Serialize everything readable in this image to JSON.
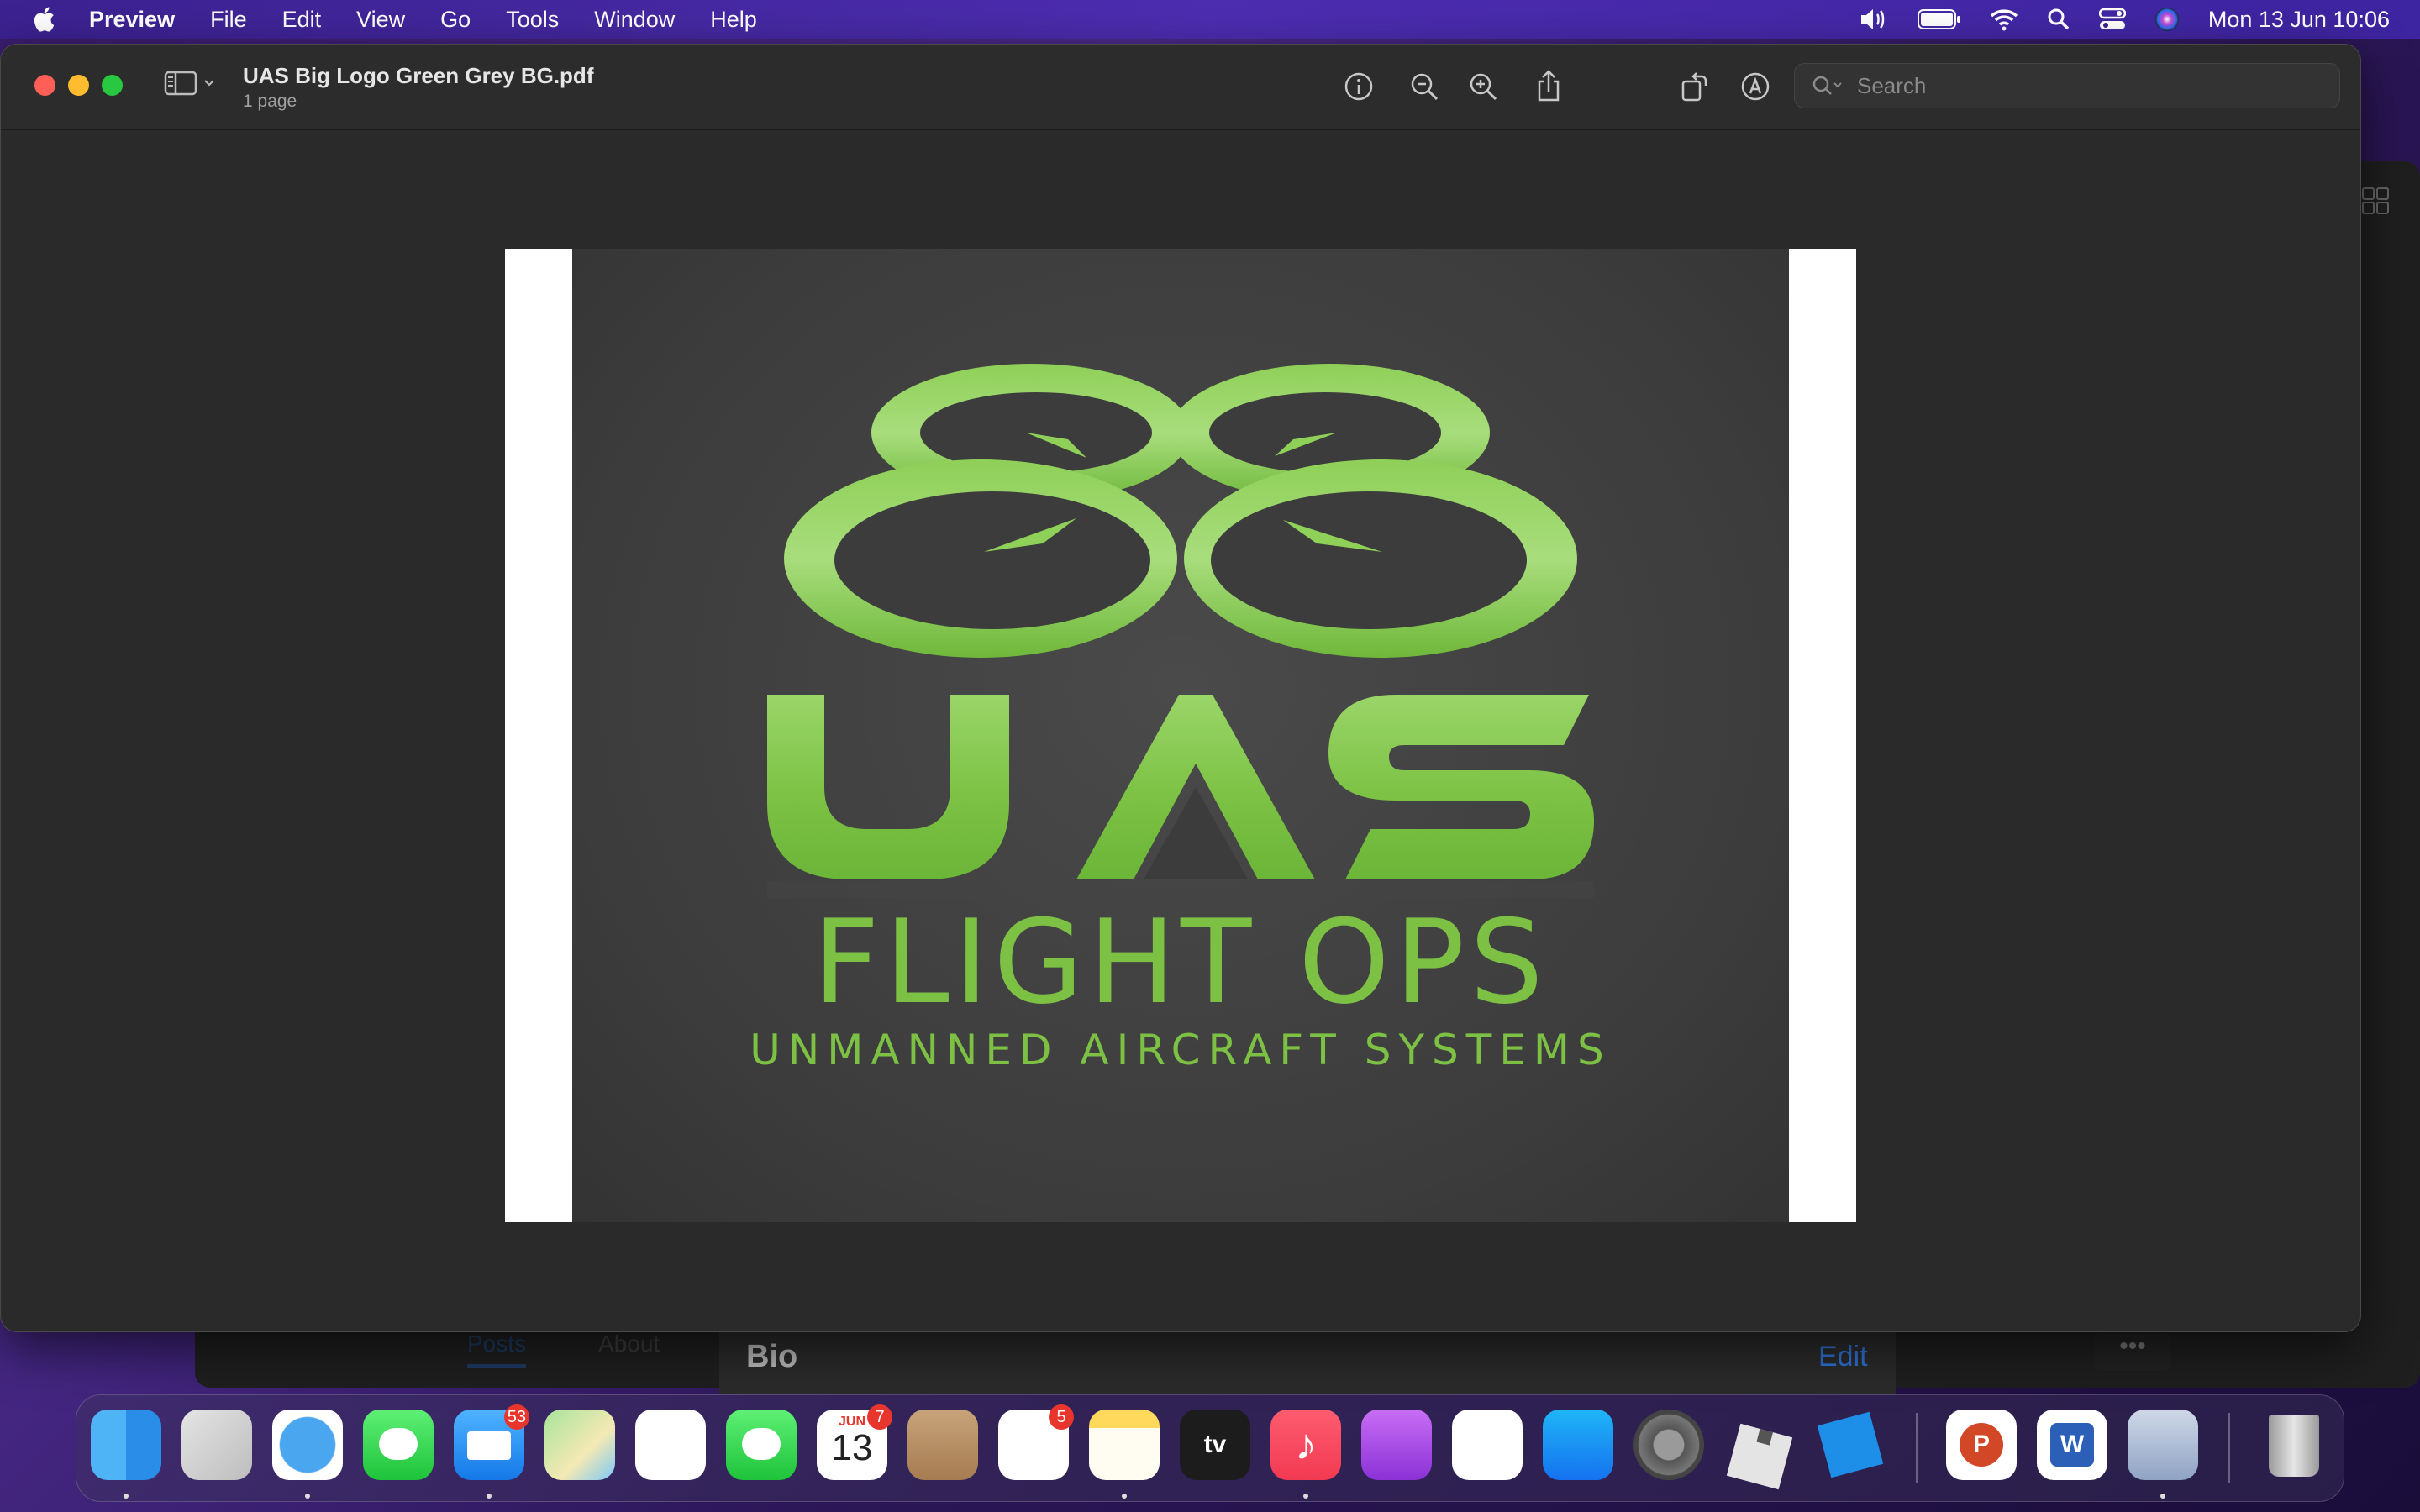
{
  "menubar": {
    "app_name": "Preview",
    "menus": [
      "File",
      "Edit",
      "View",
      "Go",
      "Tools",
      "Window",
      "Help"
    ],
    "clock": "Mon 13 Jun  10:06"
  },
  "window": {
    "title": "UAS Big Logo Green Grey BG.pdf",
    "subtitle": "1 page",
    "search_placeholder": "Search"
  },
  "document": {
    "logo_letters": "UAS",
    "logo_title": "FLIGHT OPS",
    "logo_subtitle": "UNMANNED AIRCRAFT SYSTEMS",
    "brand_green": "#7dc144"
  },
  "background_app": {
    "tabs": [
      "Posts",
      "About"
    ],
    "section_title": "Bio",
    "edit_label": "Edit",
    "more_label": "•••"
  },
  "dock": {
    "apps": [
      {
        "name": "Finder",
        "icon": "finder-icon",
        "running": true
      },
      {
        "name": "Launchpad",
        "icon": "launchpad-icon",
        "running": false
      },
      {
        "name": "Safari",
        "icon": "safari-icon",
        "running": true
      },
      {
        "name": "Messages",
        "icon": "messages-icon",
        "running": false
      },
      {
        "name": "Mail",
        "icon": "mail-icon",
        "running": true,
        "badge": "53"
      },
      {
        "name": "Maps",
        "icon": "maps-icon",
        "running": false
      },
      {
        "name": "Photos",
        "icon": "photos-icon",
        "running": false
      },
      {
        "name": "FaceTime",
        "icon": "facetime-icon",
        "running": false
      },
      {
        "name": "Calendar",
        "icon": "calendar-icon",
        "running": false,
        "badge": "7",
        "month": "JUN",
        "day": "13"
      },
      {
        "name": "Contacts",
        "icon": "contacts-icon",
        "running": false
      },
      {
        "name": "Reminders",
        "icon": "reminders-icon",
        "running": false,
        "badge": "5"
      },
      {
        "name": "Notes",
        "icon": "notes-icon",
        "running": true
      },
      {
        "name": "Apple TV",
        "icon": "tv-icon",
        "running": false,
        "label": "tv"
      },
      {
        "name": "Music",
        "icon": "music-icon",
        "running": true
      },
      {
        "name": "Podcasts",
        "icon": "podcasts-icon",
        "running": false
      },
      {
        "name": "News",
        "icon": "news-icon",
        "running": false
      },
      {
        "name": "App Store",
        "icon": "appstore-icon",
        "running": false
      },
      {
        "name": "System Preferences",
        "icon": "settings-icon",
        "running": false
      },
      {
        "name": "Roblox",
        "icon": "roblox-icon",
        "running": false
      },
      {
        "name": "Roblox Studio",
        "icon": "roblox-studio-icon",
        "running": false
      },
      {
        "name": "PowerPoint",
        "icon": "powerpoint-icon",
        "running": false,
        "label": "P"
      },
      {
        "name": "Word",
        "icon": "word-icon",
        "running": false,
        "label": "W"
      },
      {
        "name": "Preview",
        "icon": "preview-icon",
        "running": true
      },
      {
        "name": "Trash",
        "icon": "trash-icon",
        "running": false
      }
    ]
  }
}
